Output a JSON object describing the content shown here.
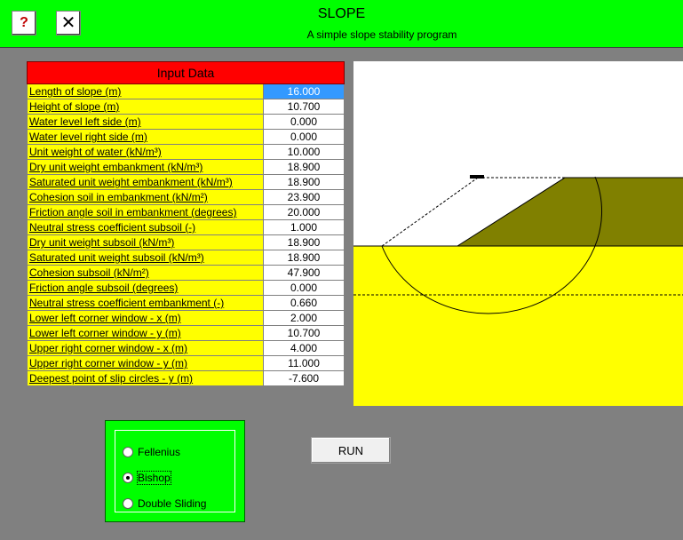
{
  "header": {
    "title": "SLOPE",
    "subtitle": "A simple slope stability program",
    "help_label": "?",
    "close_label": "✕"
  },
  "input": {
    "title": "Input Data",
    "rows": [
      {
        "label": "Length of slope (m)",
        "value": "16.000"
      },
      {
        "label": "Height of slope (m)",
        "value": "10.700"
      },
      {
        "label": "Water level left side (m)",
        "value": "0.000"
      },
      {
        "label": "Water level right side (m)",
        "value": "0.000"
      },
      {
        "label": "Unit weight of water (kN/m³)",
        "value": "10.000"
      },
      {
        "label": "Dry unit weight embankment (kN/m³)",
        "value": "18.900"
      },
      {
        "label": "Saturated unit weight embankment (kN/m³)",
        "value": "18.900"
      },
      {
        "label": "Cohesion soil in embankment (kN/m²)",
        "value": "23.900"
      },
      {
        "label": "Friction angle soil in embankment (degrees)",
        "value": "20.000"
      },
      {
        "label": "Neutral stress coefficient subsoil (-)",
        "value": "1.000"
      },
      {
        "label": "Dry unit weight subsoil (kN/m³)",
        "value": "18.900"
      },
      {
        "label": "Saturated unit weight subsoil (kN/m³)",
        "value": "18.900"
      },
      {
        "label": "Cohesion subsoil (kN/m²)",
        "value": "47.900"
      },
      {
        "label": "Friction angle subsoil (degrees)",
        "value": "0.000"
      },
      {
        "label": "Neutral stress coefficient embankment (-)",
        "value": "0.660"
      },
      {
        "label": "Lower left corner window - x (m)",
        "value": "2.000"
      },
      {
        "label": "Lower left corner window - y (m)",
        "value": "10.700"
      },
      {
        "label": "Upper right corner window - x (m)",
        "value": "4.000"
      },
      {
        "label": "Upper right corner window - y (m)",
        "value": "11.000"
      },
      {
        "label": "Deepest point of slip circles - y (m)",
        "value": "-7.600"
      }
    ]
  },
  "method": {
    "options": [
      {
        "label": "Fellenius",
        "checked": false
      },
      {
        "label": "Bishop",
        "checked": true
      },
      {
        "label": "Double Sliding",
        "checked": false
      }
    ]
  },
  "run_label": "RUN",
  "colors": {
    "header": "#00ff00",
    "subsoil": "#ffff00",
    "embankment": "#808000",
    "table_header": "#ff0000"
  }
}
